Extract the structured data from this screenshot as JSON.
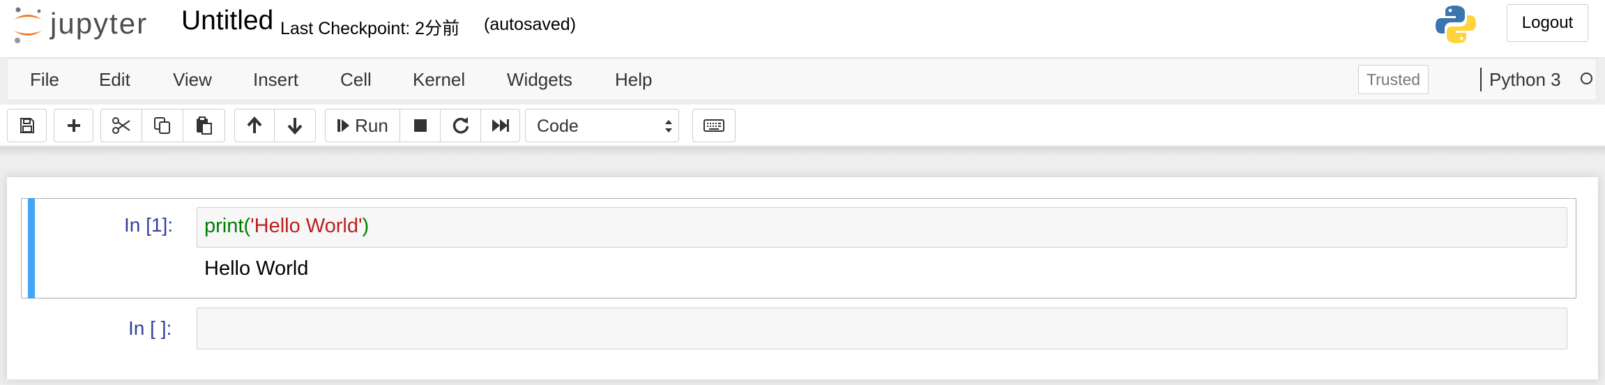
{
  "header": {
    "logo_text": "jupyter",
    "notebook_title": "Untitled",
    "checkpoint": "Last Checkpoint: 2分前",
    "autosave": "(autosaved)",
    "logout_label": "Logout"
  },
  "menubar": {
    "items": [
      "File",
      "Edit",
      "View",
      "Insert",
      "Cell",
      "Kernel",
      "Widgets",
      "Help"
    ],
    "trusted_label": "Trusted",
    "kernel_name": "Python 3"
  },
  "toolbar": {
    "buttons": [
      "save-icon",
      "plus-icon",
      "scissors-icon",
      "copy-icon",
      "paste-icon",
      "arrow-up-icon",
      "arrow-down-icon",
      "run",
      "stop-icon",
      "restart-icon",
      "fast-forward-icon",
      "keyboard-icon"
    ],
    "run_label": "Run",
    "cell_type": "Code"
  },
  "cells": [
    {
      "prompt": "In [1]:",
      "code": {
        "func": "print",
        "open": "(",
        "string": "'Hello World'",
        "close": ")"
      },
      "output": "Hello World"
    },
    {
      "prompt": "In [ ]:",
      "code": ""
    }
  ],
  "colors": {
    "selected_cell_bar": "#42a5f5",
    "prompt": "#303f9f",
    "builtin": "#008000",
    "string": "#ba2121",
    "jupyter_orange": "#f37726"
  }
}
